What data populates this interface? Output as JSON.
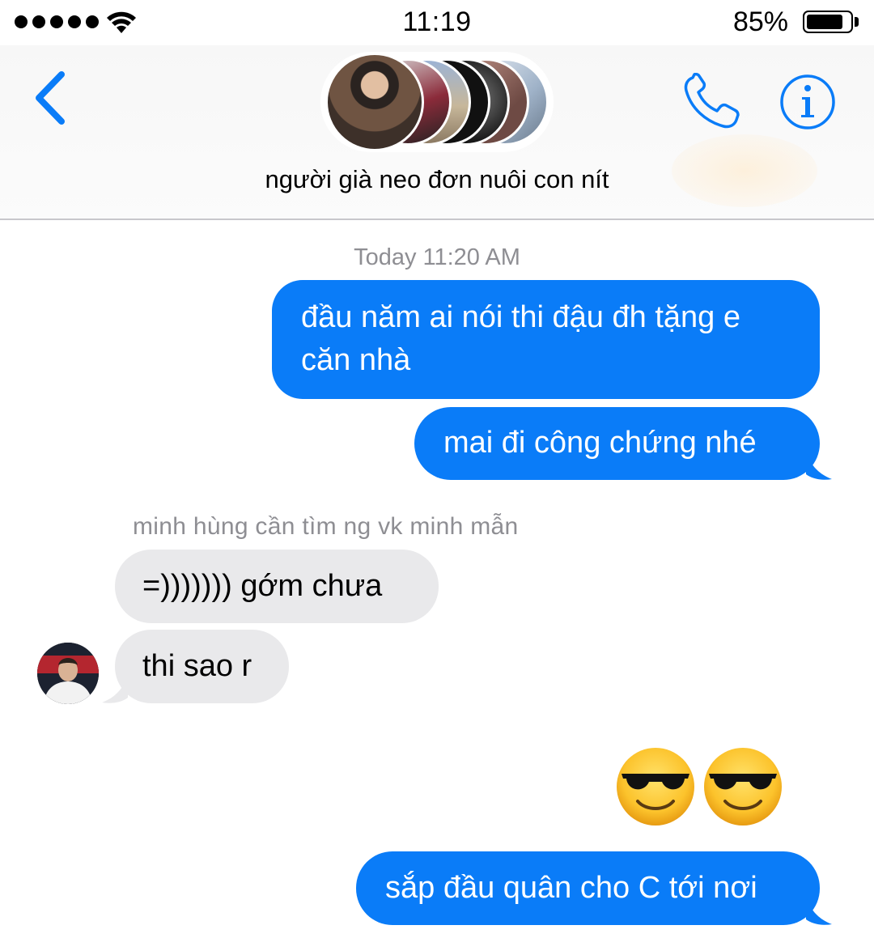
{
  "status_bar": {
    "time": "11:19",
    "battery_percent_text": "85%",
    "battery_level": 0.85,
    "signal_bars": 5
  },
  "header": {
    "back_icon": "chevron-left-icon",
    "call_icon": "phone-icon",
    "info_icon": "info-icon",
    "group_name": "người già neo đơn nuôi con nít",
    "accent_color": "#0a7cf8"
  },
  "conversation": {
    "timestamp": "Today 11:20 AM",
    "outgoing_1": "đầu năm ai nói thi đậu đh tặng e căn nhà",
    "outgoing_2": "mai đi công chứng nhé",
    "sender_name": "minh hùng cần tìm ng vk minh mẫn",
    "incoming_1": "=))))))) gớm chưa",
    "incoming_2": "thi sao r",
    "emoji_message": "😎😎",
    "outgoing_3": "sắp đầu quân cho C tới nơi",
    "outgoing_color": "#0a7cf8",
    "incoming_color": "#e9e9eb"
  }
}
